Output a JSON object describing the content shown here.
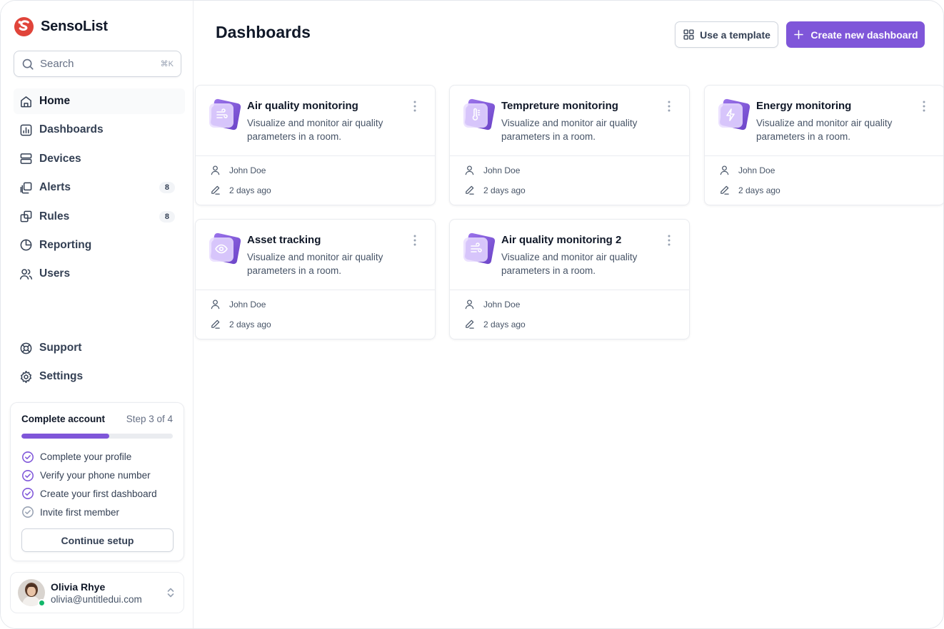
{
  "brand": {
    "name": "SensoList"
  },
  "search": {
    "placeholder": "Search",
    "shortcut": "⌘K"
  },
  "nav": {
    "items": [
      {
        "label": "Home",
        "icon": "home-icon",
        "active": true
      },
      {
        "label": "Dashboards",
        "icon": "bar-chart-icon"
      },
      {
        "label": "Devices",
        "icon": "server-icon"
      },
      {
        "label": "Alerts",
        "icon": "layers-icon",
        "badge": "8"
      },
      {
        "label": "Rules",
        "icon": "stack-icon",
        "badge": "8"
      },
      {
        "label": "Reporting",
        "icon": "pie-chart-icon"
      },
      {
        "label": "Users",
        "icon": "users-icon"
      }
    ],
    "bottom": [
      {
        "label": "Support",
        "icon": "life-buoy-icon"
      },
      {
        "label": "Settings",
        "icon": "gear-icon"
      }
    ]
  },
  "setup": {
    "title": "Complete account",
    "step_text": "Step 3 of 4",
    "progress": 0.58,
    "accent": "#7f56d9",
    "steps": [
      {
        "label": "Complete your profile",
        "done": true
      },
      {
        "label": "Verify your phone number",
        "done": true
      },
      {
        "label": "Create your first dashboard",
        "done": true
      },
      {
        "label": "Invite first member",
        "done": false
      }
    ],
    "button_label": "Continue setup"
  },
  "user": {
    "name": "Olivia Rhye",
    "email": "olivia@untitledui.com",
    "status_color": "#12b76a"
  },
  "page": {
    "title": "Dashboards",
    "template_button": "Use a template",
    "create_button": "Create new dashboard"
  },
  "dashboards": [
    {
      "title": "Air quality monitoring",
      "description": "Visualize and monitor air quality parameters in a room.",
      "author": "John Doe",
      "updated": "2 days ago",
      "icon": "wind-icon"
    },
    {
      "title": "Tempreture monitoring",
      "description": "Visualize and monitor air quality parameters in a room.",
      "author": "John Doe",
      "updated": "2 days ago",
      "icon": "thermometer-icon"
    },
    {
      "title": "Energy monitoring",
      "description": "Visualize and monitor air quality parameters in a room.",
      "author": "John Doe",
      "updated": "2 days ago",
      "icon": "lightning-icon"
    },
    {
      "title": "Asset tracking",
      "description": "Visualize and monitor air quality parameters in a room.",
      "author": "John Doe",
      "updated": "2 days ago",
      "icon": "eye-icon"
    },
    {
      "title": "Air quality monitoring 2",
      "description": "Visualize and monitor air quality parameters in a room.",
      "author": "John Doe",
      "updated": "2 days ago",
      "icon": "wind-icon"
    }
  ]
}
